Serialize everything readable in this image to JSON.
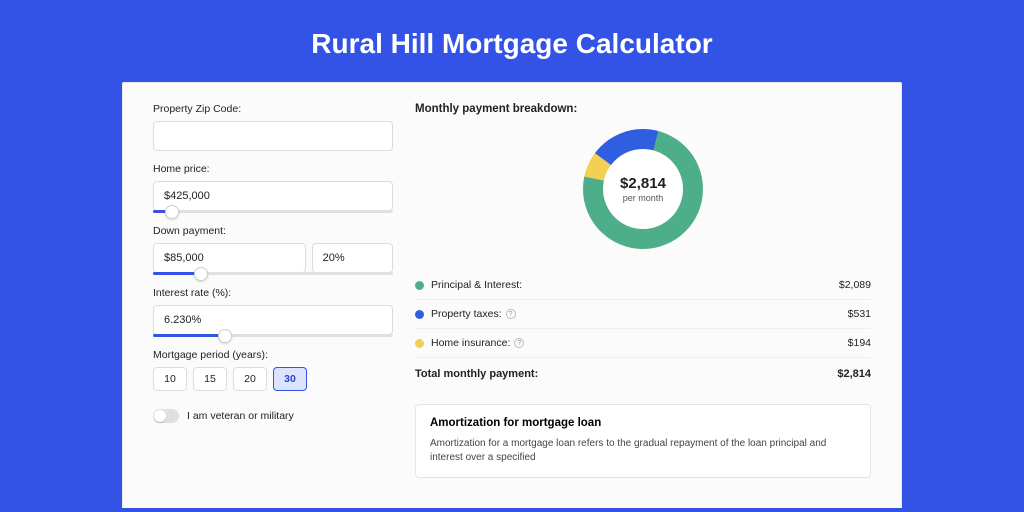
{
  "title": "Rural Hill Mortgage Calculator",
  "form": {
    "zip_label": "Property Zip Code:",
    "zip_value": "",
    "price_label": "Home price:",
    "price_value": "$425,000",
    "price_slider_pct": 8,
    "dp_label": "Down payment:",
    "dp_value": "$85,000",
    "dp_pct": "20%",
    "dp_slider_pct": 20,
    "rate_label": "Interest rate (%):",
    "rate_value": "6.230%",
    "rate_slider_pct": 30,
    "period_label": "Mortgage period (years):",
    "periods": [
      "10",
      "15",
      "20",
      "30"
    ],
    "period_selected": "30",
    "veteran_label": "I am veteran or military"
  },
  "breakdown": {
    "heading": "Monthly payment breakdown:",
    "center_amount": "$2,814",
    "center_sub": "per month",
    "items": [
      {
        "label": "Principal & Interest:",
        "value": "$2,089",
        "numeric": 2089,
        "color": "#4fae8a",
        "info": false
      },
      {
        "label": "Property taxes:",
        "value": "$531",
        "numeric": 531,
        "color": "#2f5fe0",
        "info": true
      },
      {
        "label": "Home insurance:",
        "value": "$194",
        "numeric": 194,
        "color": "#f3cf55",
        "info": true
      }
    ],
    "total_label": "Total monthly payment:",
    "total_value": "$2,814"
  },
  "chart_data": {
    "type": "pie",
    "title": "Monthly payment breakdown",
    "categories": [
      "Principal & Interest",
      "Property taxes",
      "Home insurance"
    ],
    "values": [
      2089,
      531,
      194
    ],
    "colors": [
      "#4fae8a",
      "#2f5fe0",
      "#f3cf55"
    ],
    "center_label": "$2,814 per month"
  },
  "amort": {
    "title": "Amortization for mortgage loan",
    "text": "Amortization for a mortgage loan refers to the gradual repayment of the loan principal and interest over a specified"
  }
}
